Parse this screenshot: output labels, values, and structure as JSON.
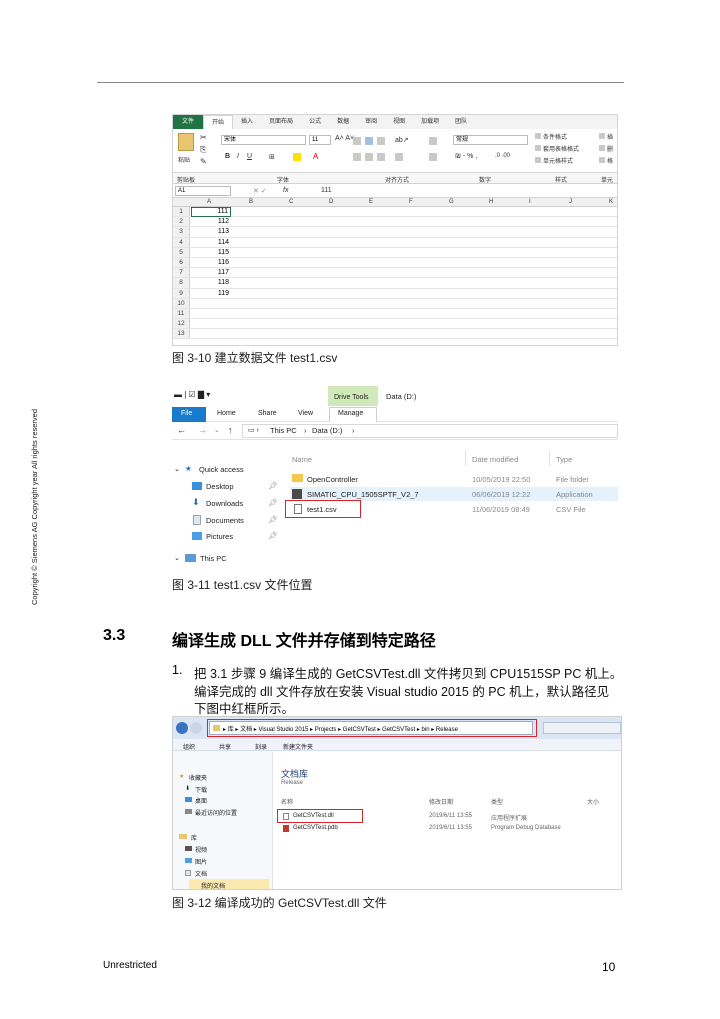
{
  "page": {
    "sidebar_copyright": "Copyright © Siemens AG Copyright year All rights reserved",
    "footer_left": "Unrestricted",
    "footer_page": "10"
  },
  "excel": {
    "tabs": [
      "文件",
      "开始",
      "插入",
      "页面布局",
      "公式",
      "数据",
      "审阅",
      "视图",
      "加载项",
      "团队"
    ],
    "font_name": "宋体",
    "font_size": "11",
    "number_format": "常规",
    "ribbon": {
      "paste": "粘贴",
      "cond_format": "条件格式",
      "table_format": "套用表格格式",
      "cell_style": "单元格样式",
      "insert": "插",
      "delete": "删",
      "format": "格"
    },
    "group_labels": [
      "剪贴板",
      "字体",
      "对齐方式",
      "数字",
      "样式",
      "单元"
    ],
    "name_box": "A1",
    "formula_value": "111",
    "formula_fx": "fx",
    "columns": [
      "A",
      "B",
      "C",
      "D",
      "E",
      "F",
      "G",
      "H",
      "I",
      "J",
      "K"
    ],
    "rows": [
      {
        "n": "1",
        "v": "111"
      },
      {
        "n": "2",
        "v": "112"
      },
      {
        "n": "3",
        "v": "113"
      },
      {
        "n": "4",
        "v": "114"
      },
      {
        "n": "5",
        "v": "115"
      },
      {
        "n": "6",
        "v": "116"
      },
      {
        "n": "7",
        "v": "117"
      },
      {
        "n": "8",
        "v": "118"
      },
      {
        "n": "9",
        "v": "119"
      },
      {
        "n": "10",
        "v": ""
      },
      {
        "n": "11",
        "v": ""
      },
      {
        "n": "12",
        "v": ""
      },
      {
        "n": "13",
        "v": ""
      }
    ],
    "caption": "图 3-10 建立数据文件 test1.csv"
  },
  "explorer1": {
    "drive_tools": "Drive Tools",
    "window_title": "Data (D:)",
    "tabs": [
      "File",
      "Home",
      "Share",
      "View",
      "Manage"
    ],
    "breadcrumb": [
      "This PC",
      "Data (D:)"
    ],
    "nav": [
      "Quick access",
      "Desktop",
      "Downloads",
      "Documents",
      "Pictures",
      "This PC"
    ],
    "columns": [
      "Name",
      "Date modified",
      "Type"
    ],
    "files": [
      {
        "name": "OpenController",
        "date": "10/05/2019 22:50",
        "type": "File folder"
      },
      {
        "name": "SIMATIC_CPU_1505SPTF_V2_7",
        "date": "06/06/2019 12:22",
        "type": "Application"
      },
      {
        "name": "test1.csv",
        "date": "11/06/2019 08:49",
        "type": "CSV File"
      }
    ],
    "caption": "图 3-11 test1.csv 文件位置"
  },
  "section": {
    "number": "3.3",
    "title": "编译生成 DLL 文件并存储到特定路径",
    "item_number": "1.",
    "lines": [
      "把 3.1 步骤 9 编译生成的 GetCSVTest.dll 文件拷贝到 CPU1515SP PC 机上。",
      "编译完成的 dll 文件存放在安装 Visual studio 2015 的 PC 机上，默认路径见",
      "下图中红框所示。"
    ]
  },
  "explorer2": {
    "breadcrumb": [
      "库",
      "文档",
      "Visual Studio 2015",
      "Projects",
      "GetCSVTest",
      "GetCSVTest",
      "bin",
      "Release"
    ],
    "toolbar": [
      "组织",
      "共享",
      "刻录",
      "新建文件夹"
    ],
    "library_title": "文档库",
    "library_sub": "Release",
    "columns": [
      "名称",
      "修改日期",
      "类型",
      "大小"
    ],
    "nav": [
      "收藏夹",
      "下载",
      "桌面",
      "最近访问的位置",
      "库",
      "视频",
      "图片",
      "文档",
      "我的文档"
    ],
    "files": [
      {
        "name": "GetCSVTest.dll",
        "date": "2019/6/11 13:55",
        "type": "应用程序扩展"
      },
      {
        "name": "GetCSVTest.pdb",
        "date": "2019/6/11 13:55",
        "type": "Program Debug Database"
      }
    ],
    "caption": "图 3-12 编译成功的 GetCSVTest.dll 文件"
  },
  "colors": {
    "excel_green": "#217346",
    "red_highlight": "#d9232d",
    "drive_tools": "#cfe9b8"
  }
}
